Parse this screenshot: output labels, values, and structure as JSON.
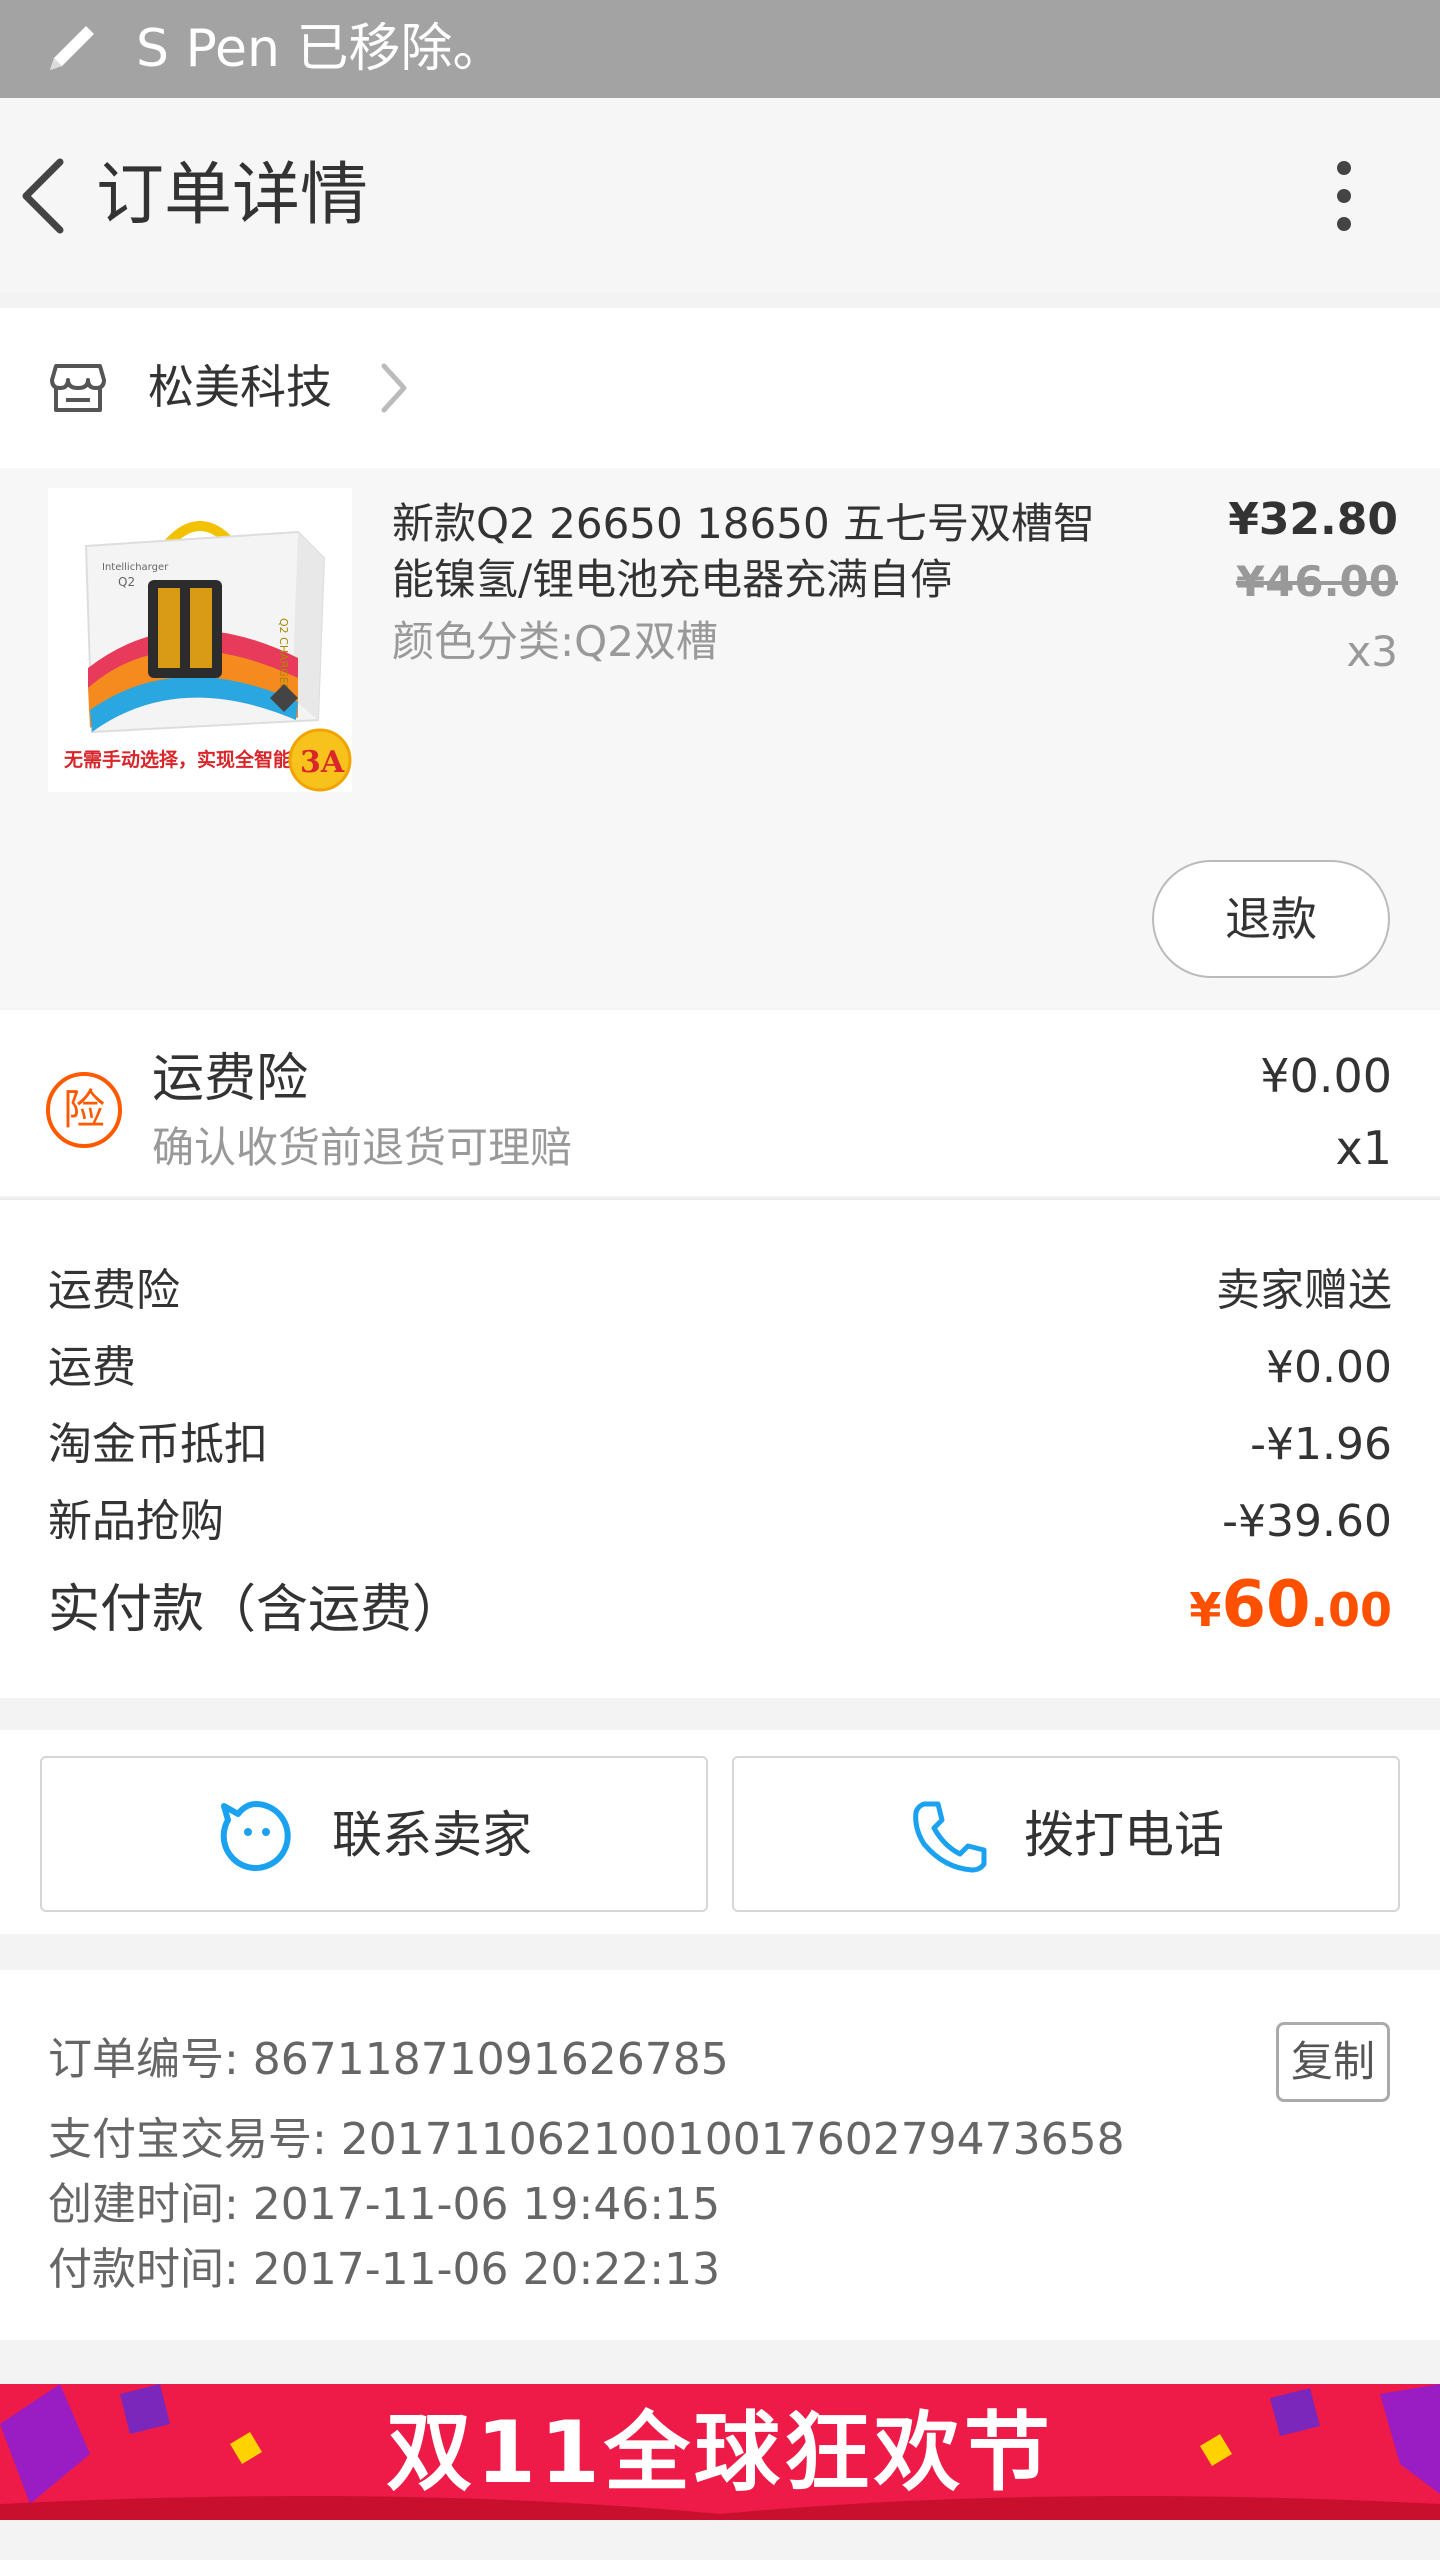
{
  "status_bar": {
    "text": "S Pen 已移除。"
  },
  "nav": {
    "title": "订单详情"
  },
  "shop": {
    "name": "松美科技"
  },
  "item": {
    "title": "新款Q2 26650 18650 五七号双槽智能镍氢/锂电池充电器充满自停",
    "sku": "颜色分类:Q2双槽",
    "price": "¥32.80",
    "original_price": "¥46.00",
    "quantity": "x3",
    "refund_label": "退款",
    "image_text": {
      "brand": "Intellicharger",
      "model": "Q2",
      "side_text": "Q2 CHARGER",
      "caption": "无需手动选择，实现全智能。",
      "badge": "3A"
    }
  },
  "insurance": {
    "badge": "险",
    "title": "运费险",
    "subtitle": "确认收货前退货可理赔",
    "price": "¥0.00",
    "quantity": "x1"
  },
  "fees": [
    {
      "label": "运费险",
      "value": "卖家赠送"
    },
    {
      "label": "运费",
      "value": "¥0.00"
    },
    {
      "label": "淘金币抵扣",
      "value": "-¥1.96"
    },
    {
      "label": "新品抢购",
      "value": "-¥39.60"
    }
  ],
  "total": {
    "label": "实付款（含运费）",
    "currency": "¥",
    "integer": "60",
    "decimal": ".00"
  },
  "actions": {
    "contact_seller": "联系卖家",
    "call_phone": "拨打电话"
  },
  "order_meta": {
    "order_no": "订单编号: 867118710916267​85",
    "alipay_no": "支付宝交易号: 2017110621001001760279473658",
    "created": "创建时间: 2017-11-06 19:46:15",
    "paid": "付款时间: 2017-11-06 20:22:13",
    "copy_label": "复制"
  },
  "banner": {
    "text": "双11全球狂欢节"
  },
  "colors": {
    "accent": "#ff5000",
    "insurance": "#ff5a00",
    "link_blue": "#1aa1f0",
    "banner_red": "#ee1a47"
  }
}
